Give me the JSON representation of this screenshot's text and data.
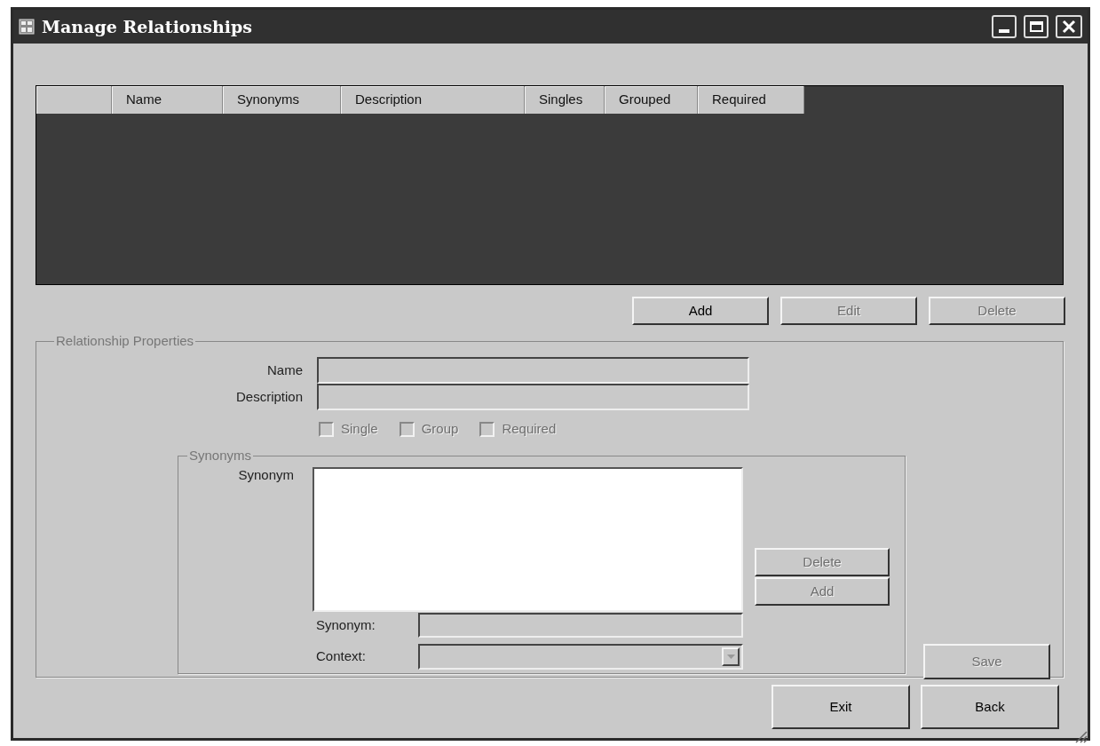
{
  "window": {
    "title": "Manage Relationships"
  },
  "table": {
    "columns": [
      {},
      {
        "label": "Name"
      },
      {
        "label": "Synonyms"
      },
      {
        "label": "Description"
      },
      {
        "label": "Singles"
      },
      {
        "label": "Grouped"
      },
      {
        "label": "Required"
      }
    ]
  },
  "table_buttons": [
    {
      "label": "Add",
      "disabled": false
    },
    {
      "label": "Edit",
      "disabled": true
    },
    {
      "label": "Delete",
      "disabled": true
    }
  ],
  "properties": {
    "title": "Relationship Properties",
    "fields": [
      {
        "label": "Name",
        "disabled": true
      },
      {
        "label": "Description",
        "disabled": true
      }
    ],
    "checkboxes": [
      {
        "label": "Single",
        "checked": false,
        "disabled": true
      },
      {
        "label": "Group",
        "checked": false,
        "disabled": true
      },
      {
        "label": "Required",
        "checked": false,
        "disabled": true
      }
    ],
    "synonyms": {
      "title": "Synonyms",
      "list_label": "Synonym",
      "buttons": [
        {
          "label": "Delete",
          "disabled": true
        },
        {
          "label": "Add",
          "disabled": true
        }
      ],
      "synonym_field": {
        "label": "Synonym:",
        "disabled": true
      },
      "context_field": {
        "label": "Context:",
        "disabled": true
      }
    },
    "save_button": {
      "label": "Save",
      "disabled": true
    }
  },
  "footer_buttons": [
    {
      "label": "Exit",
      "disabled": false
    },
    {
      "label": "Back",
      "disabled": false
    }
  ]
}
